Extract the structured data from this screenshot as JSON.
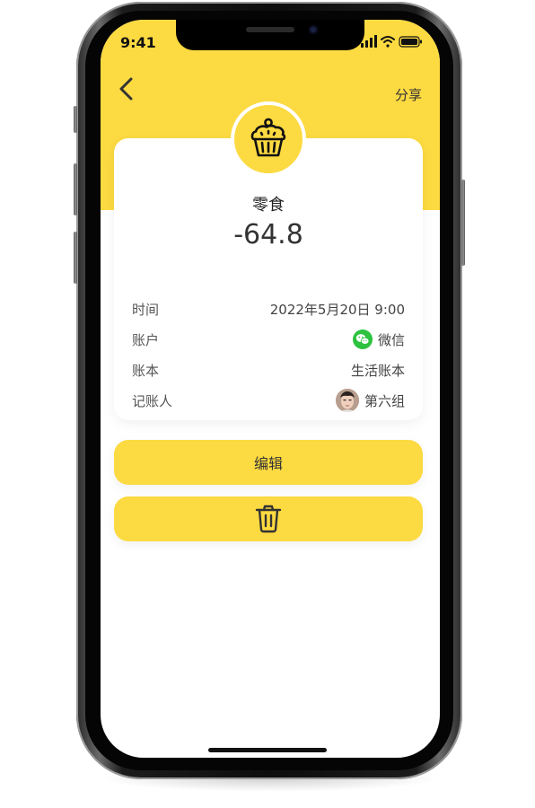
{
  "status_bar": {
    "time": "9:41"
  },
  "header": {
    "share_label": "分享"
  },
  "transaction": {
    "category": "零食",
    "amount": "-64.8",
    "rows": [
      {
        "label": "时间",
        "value": "2022年5月20日 9:00"
      },
      {
        "label": "账户",
        "value": "微信"
      },
      {
        "label": "账本",
        "value": "生活账本"
      },
      {
        "label": "记账人",
        "value": "第六组"
      }
    ]
  },
  "actions": {
    "edit_label": "编辑"
  },
  "icons": {
    "back": "chevron-left-icon",
    "category": "cupcake-icon",
    "account": "wechat-icon",
    "delete": "trash-icon"
  },
  "colors": {
    "accent": "#fcda41",
    "wechat": "#2dc23f"
  }
}
